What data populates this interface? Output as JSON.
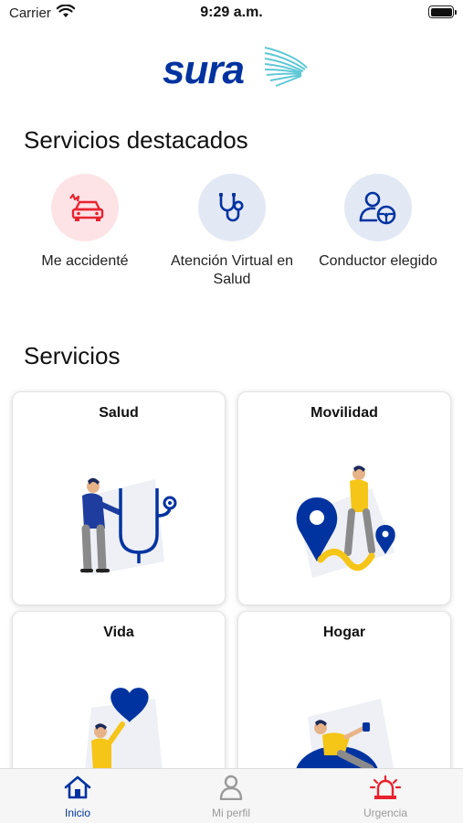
{
  "status_bar": {
    "carrier": "Carrier",
    "time": "9:29 a.m."
  },
  "brand": {
    "logo_text": "sura",
    "primary_color": "#0033a0",
    "accent_color": "#5ec8d6"
  },
  "featured": {
    "title": "Servicios destacados",
    "items": [
      {
        "label": "Me accidenté",
        "icon": "car-crash-icon",
        "color": "#e8232f"
      },
      {
        "label": "Atención Virtual en Salud",
        "icon": "stethoscope-icon",
        "color": "#0033a0"
      },
      {
        "label": "Conductor elegido",
        "icon": "designated-driver-icon",
        "color": "#0033a0"
      }
    ]
  },
  "services": {
    "title": "Servicios",
    "cards": [
      {
        "label": "Salud",
        "illustration": "doctor-stethoscope-illustration"
      },
      {
        "label": "Movilidad",
        "illustration": "map-pin-person-illustration"
      },
      {
        "label": "Vida",
        "illustration": "person-heart-illustration"
      },
      {
        "label": "Hogar",
        "illustration": "person-relaxing-beanbag-illustration"
      }
    ]
  },
  "tab_bar": {
    "items": [
      {
        "label": "Inicio",
        "icon": "home-icon",
        "active": true
      },
      {
        "label": "Mi perfil",
        "icon": "person-icon",
        "active": false
      },
      {
        "label": "Urgencia",
        "icon": "siren-icon",
        "active": false
      }
    ]
  }
}
